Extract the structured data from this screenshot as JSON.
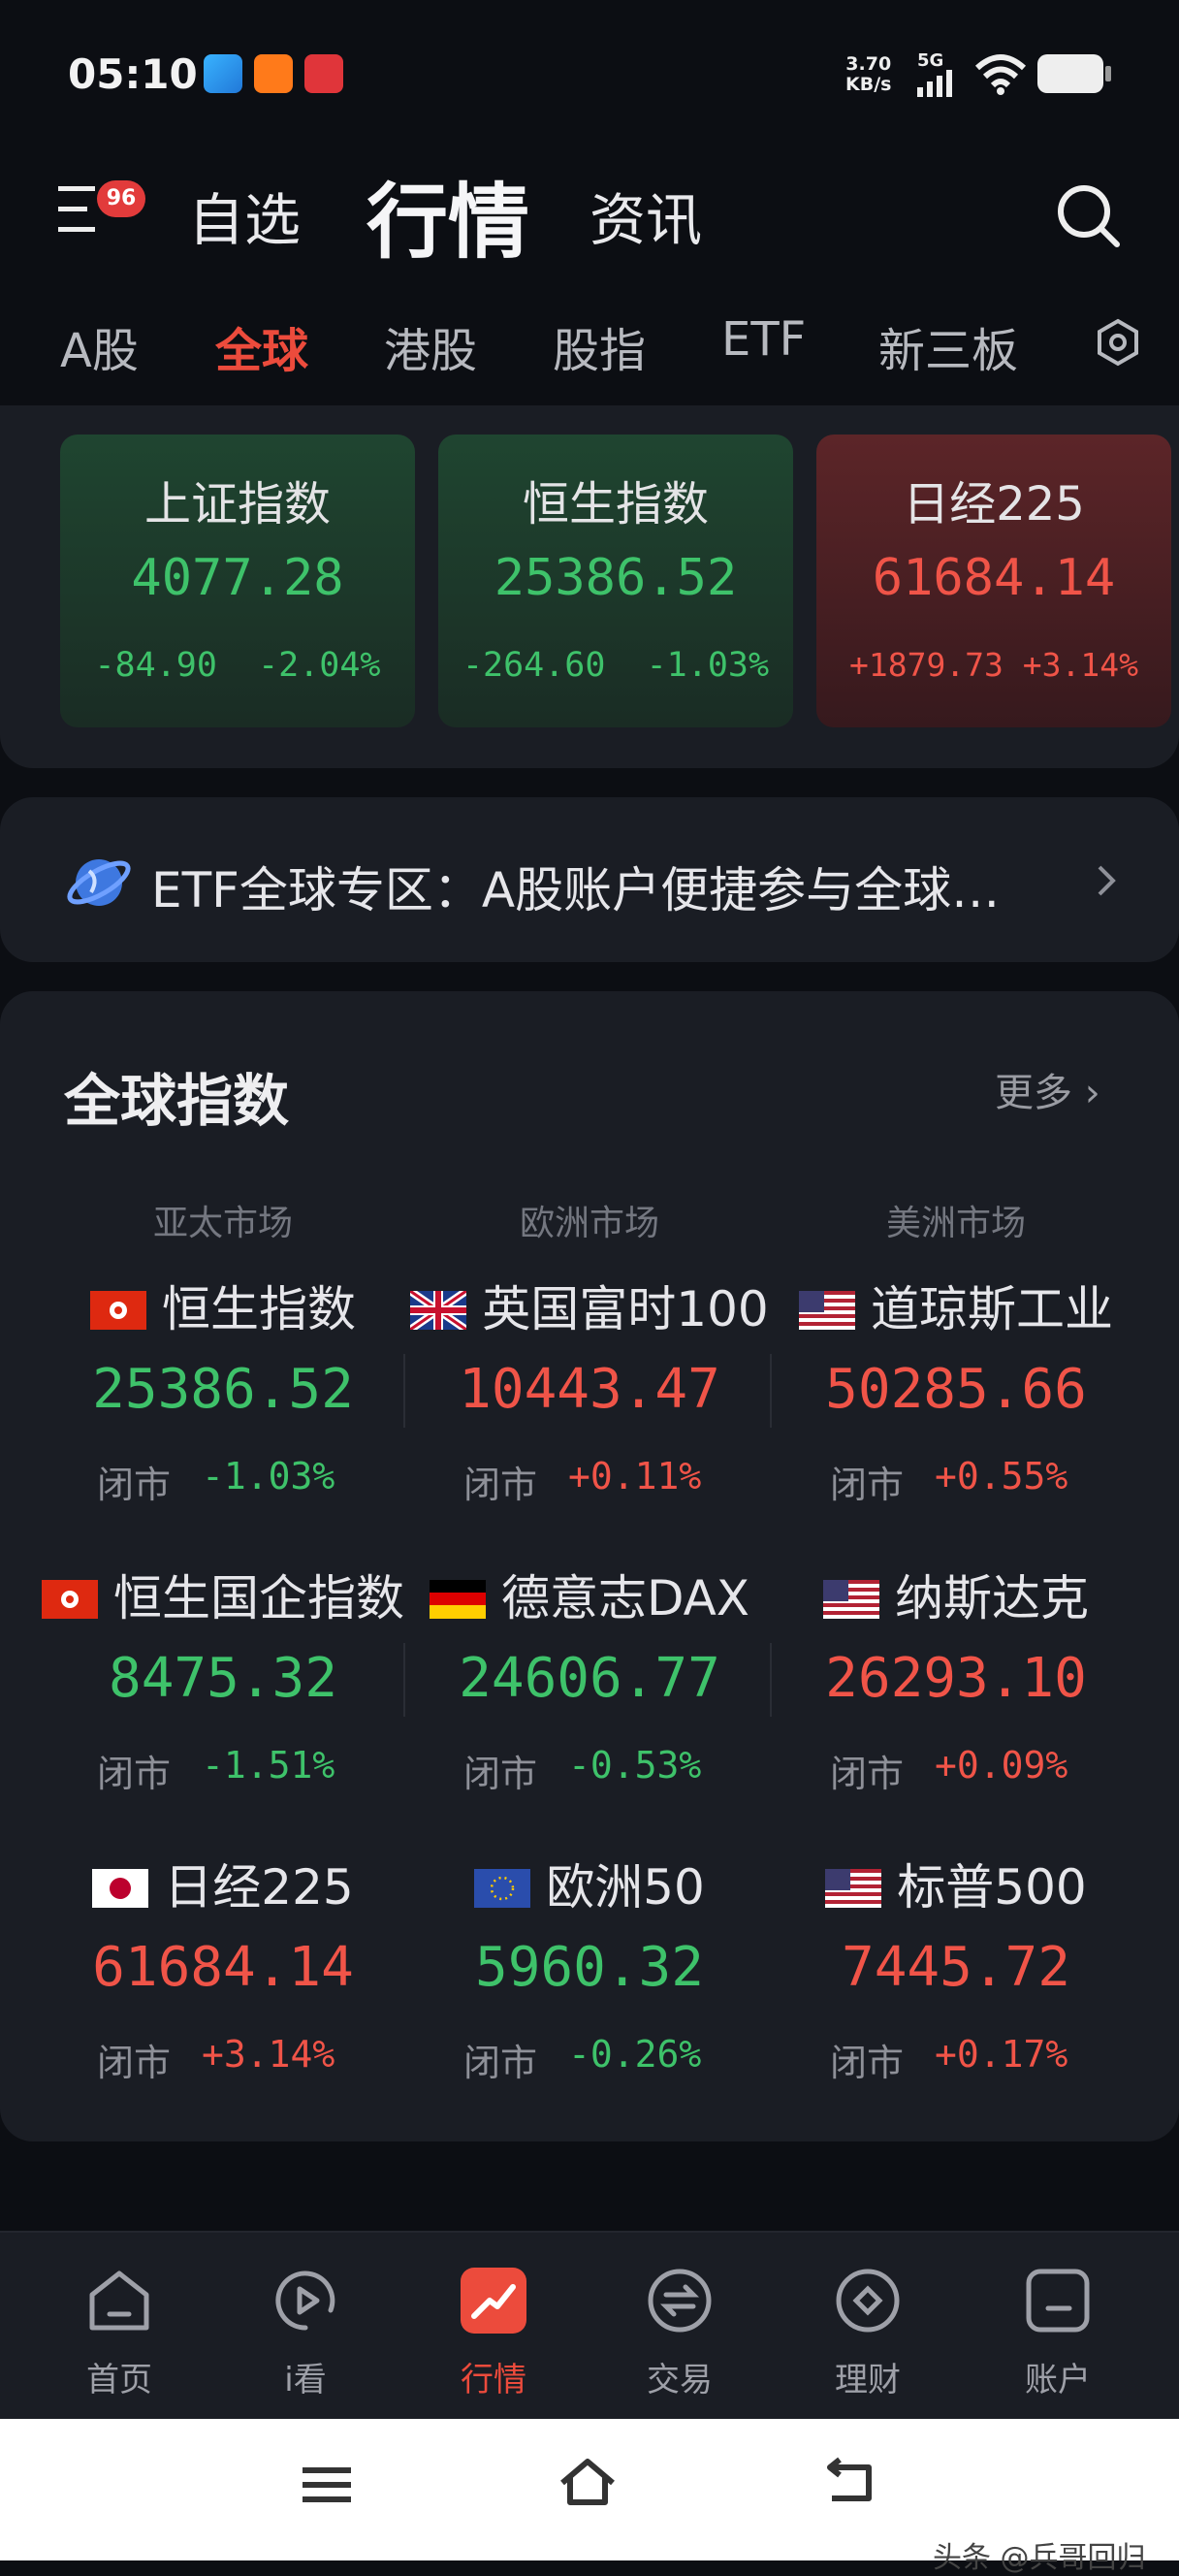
{
  "status_bar": {
    "time": "05:10",
    "net_speed_value": "3.70",
    "net_speed_unit": "KB/s",
    "signal": "5G"
  },
  "header": {
    "badge": "96",
    "tabs": [
      {
        "label": "自选",
        "active": false
      },
      {
        "label": "行情",
        "active": true
      },
      {
        "label": "资讯",
        "active": false
      }
    ]
  },
  "sub_tabs": [
    {
      "label": "A股",
      "active": false
    },
    {
      "label": "全球",
      "active": true
    },
    {
      "label": "港股",
      "active": false
    },
    {
      "label": "股指",
      "active": false
    },
    {
      "label": "ETF",
      "active": false
    },
    {
      "label": "新三板",
      "active": false
    }
  ],
  "index_cards": [
    {
      "name": "上证指数",
      "value": "4077.28",
      "change": "-84.90",
      "pct": "-2.04%",
      "trend": "down"
    },
    {
      "name": "恒生指数",
      "value": "25386.52",
      "change": "-264.60",
      "pct": "-1.03%",
      "trend": "down"
    },
    {
      "name": "日经225",
      "value": "61684.14",
      "change": "+1879.73",
      "pct": "+3.14%",
      "trend": "up"
    }
  ],
  "banner": {
    "text": "ETF全球专区：A股账户便捷参与全球…",
    "icon": "globe-icon"
  },
  "global_indices": {
    "title": "全球指数",
    "more": "更多",
    "columns": [
      "亚太市场",
      "欧洲市场",
      "美洲市场"
    ],
    "rows": [
      [
        {
          "name": "恒生指数",
          "flag": "hk",
          "value": "25386.52",
          "status": "闭市",
          "pct": "-1.03%",
          "trend": "down"
        },
        {
          "name": "英国富时100",
          "flag": "uk",
          "value": "10443.47",
          "status": "闭市",
          "pct": "+0.11%",
          "trend": "up"
        },
        {
          "name": "道琼斯工业",
          "flag": "us",
          "value": "50285.66",
          "status": "闭市",
          "pct": "+0.55%",
          "trend": "up"
        }
      ],
      [
        {
          "name": "恒生国企指数",
          "flag": "hk",
          "value": "8475.32",
          "status": "闭市",
          "pct": "-1.51%",
          "trend": "down"
        },
        {
          "name": "德意志DAX",
          "flag": "de",
          "value": "24606.77",
          "status": "闭市",
          "pct": "-0.53%",
          "trend": "down"
        },
        {
          "name": "纳斯达克",
          "flag": "us",
          "value": "26293.10",
          "status": "闭市",
          "pct": "+0.09%",
          "trend": "up"
        }
      ],
      [
        {
          "name": "日经225",
          "flag": "jp",
          "value": "61684.14",
          "status": "闭市",
          "pct": "+3.14%",
          "trend": "up"
        },
        {
          "name": "欧洲50",
          "flag": "eu",
          "value": "5960.32",
          "status": "闭市",
          "pct": "-0.26%",
          "trend": "down"
        },
        {
          "name": "标普500",
          "flag": "us",
          "value": "7445.72",
          "status": "闭市",
          "pct": "+0.17%",
          "trend": "up"
        }
      ]
    ]
  },
  "bottom_nav": [
    {
      "label": "首页",
      "icon": "home-icon",
      "active": false
    },
    {
      "label": "i看",
      "icon": "play-icon",
      "active": false
    },
    {
      "label": "行情",
      "icon": "market-icon",
      "active": true
    },
    {
      "label": "交易",
      "icon": "trade-icon",
      "active": false
    },
    {
      "label": "理财",
      "icon": "wealth-icon",
      "active": false
    },
    {
      "label": "账户",
      "icon": "account-icon",
      "active": false
    }
  ],
  "watermark": "头条 @兵哥回归",
  "colors": {
    "up": "#f05448",
    "down": "#3ec26a",
    "accent": "#ec4b3c",
    "background": "#0c0e13",
    "panel": "#1a1d24"
  }
}
